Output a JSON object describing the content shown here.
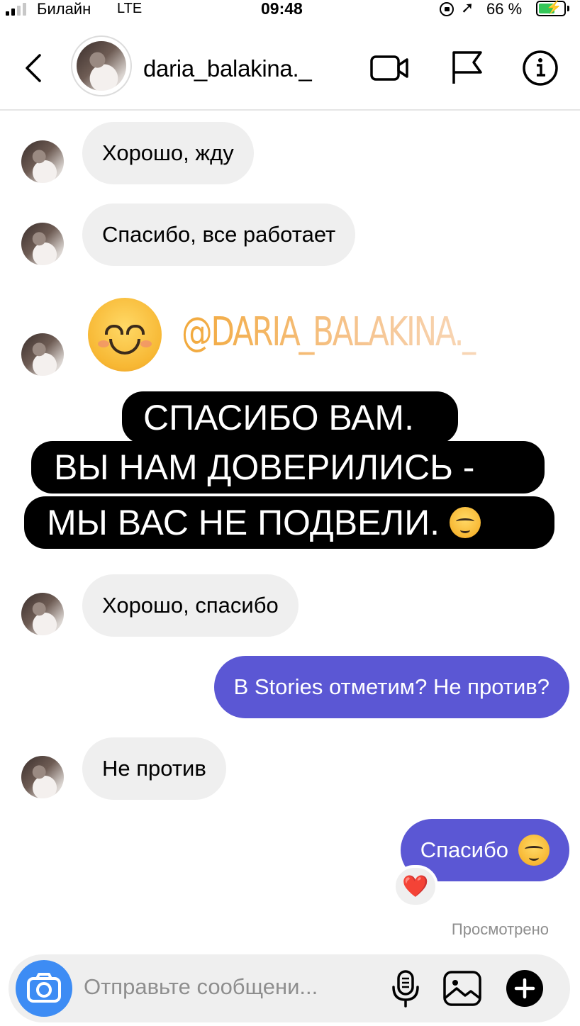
{
  "status_bar": {
    "carrier": "Билайн",
    "network": "LTE",
    "time": "09:48",
    "battery_percent": "66 %",
    "battery_level": 0.66,
    "icons": [
      "rotation-lock-icon",
      "location-arrow-icon",
      "battery-charging-icon"
    ]
  },
  "header": {
    "username": "daria_balakina._",
    "icons": [
      "back-chevron-icon",
      "video-call-icon",
      "flag-icon",
      "info-icon"
    ]
  },
  "messages": [
    {
      "type": "incoming",
      "text": "Хорошо, жду"
    },
    {
      "type": "incoming",
      "text": "Спасибо, все работает"
    },
    {
      "type": "story-mention",
      "tag": "@DARIA_BALAKINA._",
      "lines": [
        "СПАСИБО ВАМ.",
        "ВЫ НАМ ДОВЕРИЛИСЬ -",
        "МЫ ВАС НЕ ПОДВЕЛИ."
      ]
    },
    {
      "type": "incoming",
      "text": "Хорошо, спасибо"
    },
    {
      "type": "outgoing",
      "text": "В Stories отметим? Не против?"
    },
    {
      "type": "incoming",
      "text": "Не против"
    },
    {
      "type": "outgoing",
      "text": "Спасибо",
      "reaction": "❤️"
    }
  ],
  "seen_label": "Просмотрено",
  "composer": {
    "placeholder": "Отправьте сообщени...",
    "icons": [
      "camera-icon",
      "microphone-icon",
      "gallery-icon",
      "plus-icon"
    ]
  },
  "colors": {
    "outgoing_bubble": "#5b57d4",
    "incoming_bubble": "#efefef",
    "camera_button": "#3d8cf4"
  }
}
